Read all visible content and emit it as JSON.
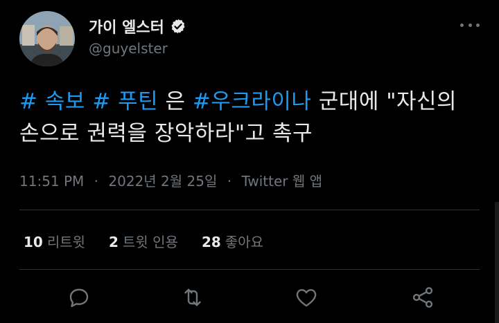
{
  "author": {
    "display_name": "가이 엘스터",
    "handle": "@guyelster",
    "verified": true,
    "avatar_icon": "user-avatar"
  },
  "tweet": {
    "segments": [
      {
        "text": "# 속보",
        "type": "hashtag"
      },
      {
        "text": " ",
        "type": "text"
      },
      {
        "text": "# 푸틴",
        "type": "hashtag"
      },
      {
        "text": " 은 ",
        "type": "text"
      },
      {
        "text": "#우크라이나",
        "type": "hashtag"
      },
      {
        "text": " 군대에 \"자신의 손으로 권력을 장악하라\"고 촉구",
        "type": "text"
      }
    ]
  },
  "meta": {
    "time": "11:51 PM",
    "date": "2022년 2월 25일",
    "separator": "·",
    "source": "Twitter 웹 앱"
  },
  "stats": {
    "retweets": {
      "count": "10",
      "label": "리트윗"
    },
    "quotes": {
      "count": "2",
      "label": "트윗 인용"
    },
    "likes": {
      "count": "28",
      "label": "좋아요"
    }
  },
  "actions": [
    "reply-icon",
    "retweet-icon",
    "like-icon",
    "share-icon"
  ],
  "colors": {
    "background": "#000000",
    "text": "#e7e9ea",
    "muted": "#71767b",
    "link": "#1d9bf0",
    "divider": "#2f3336"
  }
}
